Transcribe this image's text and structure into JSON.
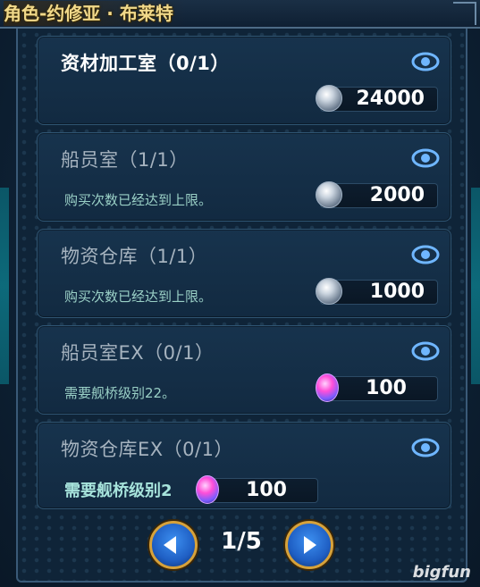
{
  "header": {
    "title": "角色-约修亚 · 布莱特"
  },
  "items": [
    {
      "title": "资材加工室（0/1）",
      "note": "",
      "price": "24000",
      "currency": "coin",
      "state": "active"
    },
    {
      "title": "船员室（1/1）",
      "note": "购买次数已经达到上限。",
      "price": "2000",
      "currency": "coin",
      "state": "dim"
    },
    {
      "title": "物资仓库（1/1）",
      "note": "购买次数已经达到上限。",
      "price": "1000",
      "currency": "coin",
      "state": "dim"
    },
    {
      "title": "船员室EX（0/1）",
      "note": "需要舰桥级别22。",
      "price": "100",
      "currency": "gem",
      "state": "dim"
    },
    {
      "title": "物资仓库EX（0/1）",
      "note": "需要舰桥级别2",
      "price": "100",
      "currency": "gem",
      "state": "dim"
    }
  ],
  "pager": {
    "label": "1/5"
  },
  "brand": {
    "label": "bigfun"
  },
  "colors": {
    "accent_gold": "#d7a23a",
    "title_gold": "#f1d98a",
    "note_teal": "#9ad0c6"
  }
}
